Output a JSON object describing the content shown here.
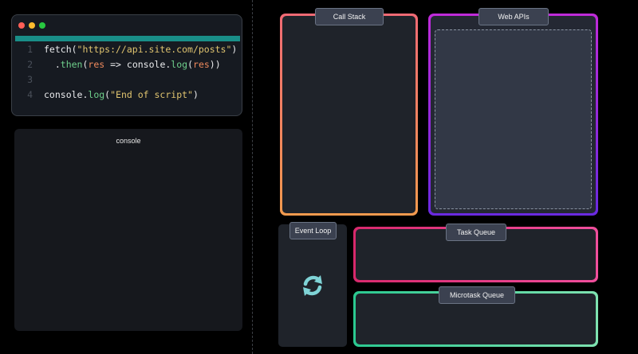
{
  "editor": {
    "lines": [
      {
        "num": "1",
        "fn": "fetch(",
        "str": "\"https://api.site.com/posts\"",
        "end": ")"
      },
      {
        "num": "2",
        "pre": "  .",
        "meth": "then",
        "p1": "(",
        "var": "res",
        "arrow": " => console.",
        "meth2": "log",
        "p2": "(",
        "var2": "res",
        "end": "))"
      },
      {
        "num": "3"
      },
      {
        "num": "4",
        "fn": "console.",
        "meth": "log",
        "p1": "(",
        "str": "\"End of script\"",
        "end": ")"
      }
    ]
  },
  "console": {
    "title": "console"
  },
  "panels": {
    "call_stack": "Call Stack",
    "web_apis": "Web APIs",
    "event_loop": "Event Loop",
    "task_queue": "Task Queue",
    "microtask_queue": "Microtask Queue"
  },
  "colors": {
    "dot_red": "#ff5f57",
    "dot_yellow": "#febc2e",
    "dot_green": "#28c840",
    "loop_icon": "#7fd3d6"
  },
  "icons": {
    "event_loop": "refresh-icon",
    "window_controls": "traffic-light-dots"
  }
}
